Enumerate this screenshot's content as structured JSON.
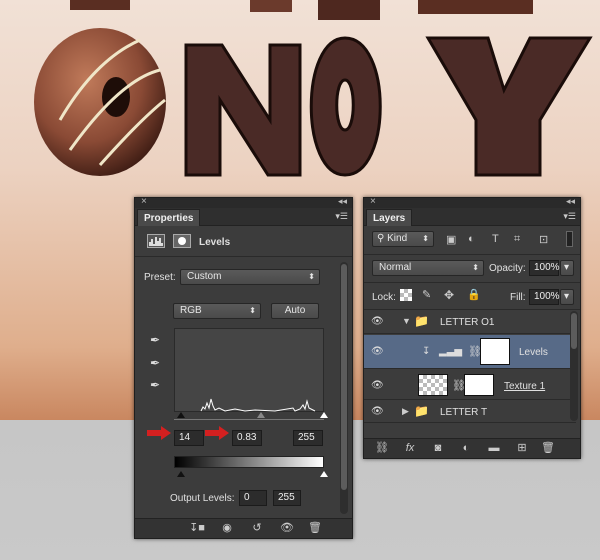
{
  "properties_panel": {
    "tab_label": "Properties",
    "adjustment_name": "Levels",
    "preset_label": "Preset:",
    "preset_value": "Custom",
    "channel_value": "RGB",
    "auto_label": "Auto",
    "input_black": "14",
    "input_gamma": "0.83",
    "input_white": "255",
    "output_label": "Output Levels:",
    "output_black": "0",
    "output_white": "255"
  },
  "layers_panel": {
    "tab_label": "Layers",
    "filter_kind": "Kind",
    "blend_mode": "Normal",
    "opacity_label": "Opacity:",
    "opacity_value": "100%",
    "lock_label": "Lock:",
    "fill_label": "Fill:",
    "fill_value": "100%",
    "layers": [
      {
        "name": "LETTER O1",
        "type": "group",
        "expanded": true
      },
      {
        "name": "Levels",
        "type": "adjustment",
        "selected": true
      },
      {
        "name": "Texture 1",
        "type": "layer"
      },
      {
        "name": "LETTER T",
        "type": "group",
        "expanded": false
      }
    ]
  },
  "colors": {
    "panel_bg": "#3c3c3c",
    "selection": "#576a87",
    "arrow_red": "#d42020",
    "chocolate": "#4a2a26"
  },
  "icons": [
    "close-icon",
    "collapse-icon",
    "panel-menu-icon",
    "histogram-icon",
    "mask-icon",
    "eyedropper-black-icon",
    "eyedropper-gray-icon",
    "eyedropper-white-icon",
    "eye-icon",
    "folder-icon",
    "link-icon",
    "search-icon",
    "trash-icon"
  ]
}
